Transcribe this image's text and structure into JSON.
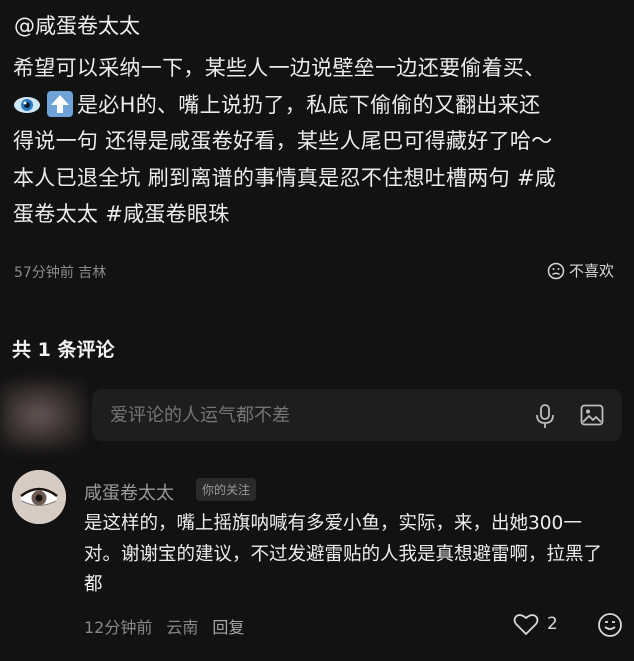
{
  "post": {
    "author": "@咸蛋卷太太",
    "line1": "希望可以采纳一下，某些人一边说壁垒一边还要偷着买、",
    "line2_after_icons": "是必H的、嘴上说扔了，私底下偷偷的又翻出来还",
    "line3": "得说一句 还得是咸蛋卷好看，某些人尾巴可得藏好了哈～",
    "line4": "本人已退全坑 刷到离谱的事情真是忍不住想吐槽两句",
    "hashtag1_part1": "#咸",
    "hashtag1_part2": "蛋卷太太",
    "hashtag2": "#咸蛋卷眼珠",
    "time": "57分钟前",
    "location": "吉林",
    "dislike_label": "不喜欢",
    "icons": [
      "eye-emoji",
      "up-arrow-emoji"
    ]
  },
  "comments_section": {
    "count_label": "共 1 条评论",
    "input_placeholder": "爱评论的人运气都不差"
  },
  "comment": {
    "author": "咸蛋卷太太",
    "badge": "你的关注",
    "text": "是这样的，嘴上摇旗呐喊有多爱小鱼，实际，来，出她300一对。谢谢宝的建议，不过发避雷贴的人我是真想避雷啊，拉黑了都",
    "time": "12分钟前",
    "location": "云南",
    "reply_label": "回复",
    "like_count": "2"
  },
  "colors": {
    "background": "#121212",
    "text": "#ececec",
    "muted": "#8a8a8a",
    "input_bg": "#1e1e1e"
  }
}
